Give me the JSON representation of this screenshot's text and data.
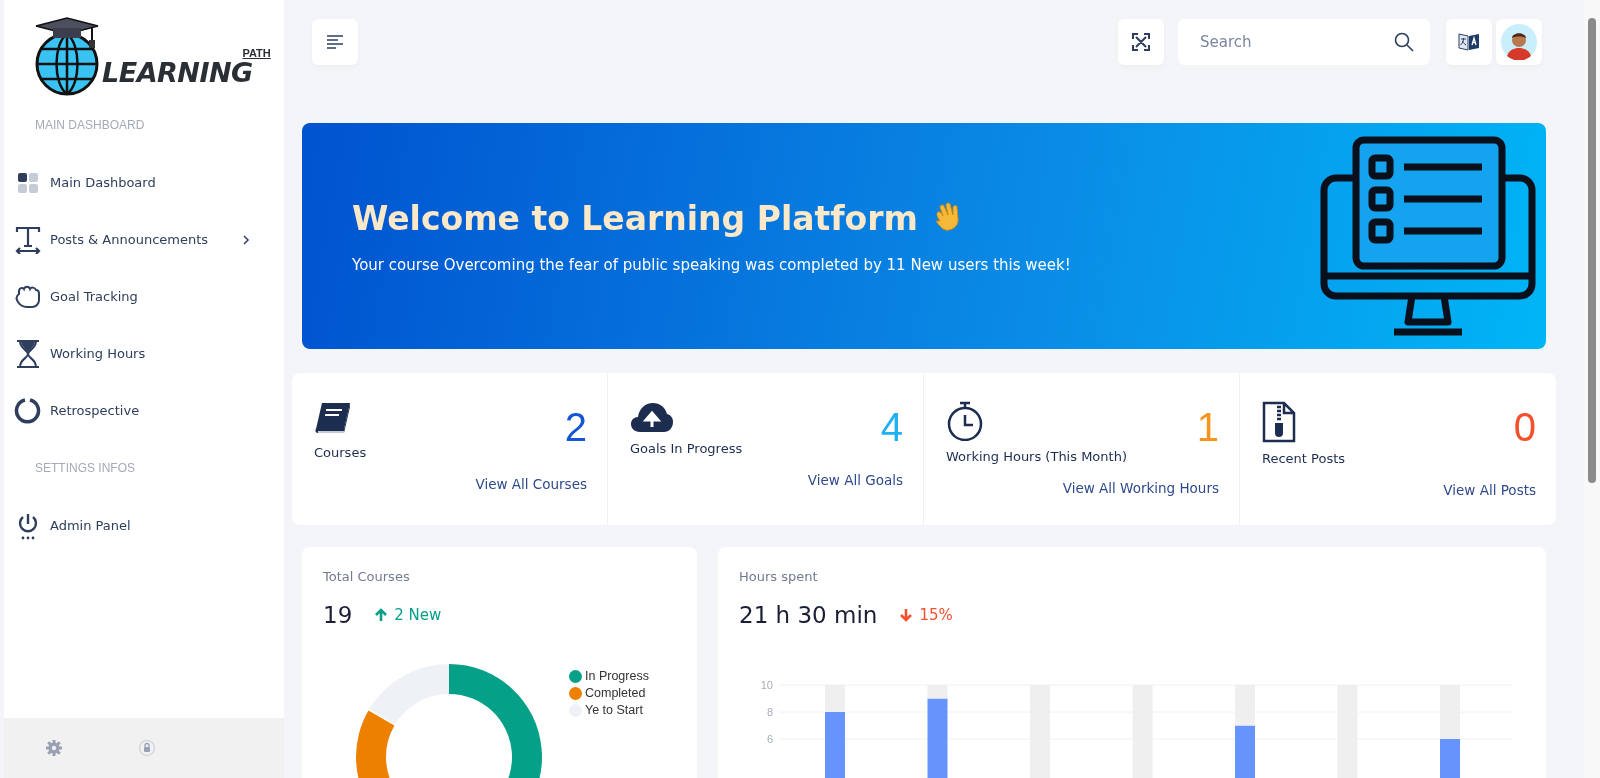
{
  "logo": {
    "word": "LEARNING",
    "tag": "PATH"
  },
  "sidebar": {
    "sections": [
      {
        "title": "MAIN DASHBOARD",
        "items": [
          {
            "label": "Main Dashboard",
            "has_submenu": false
          },
          {
            "label": "Posts & Announcements",
            "has_submenu": true
          },
          {
            "label": "Goal Tracking",
            "has_submenu": false
          },
          {
            "label": "Working Hours",
            "has_submenu": false
          },
          {
            "label": "Retrospective",
            "has_submenu": false
          }
        ]
      },
      {
        "title": "SETTINGS INFOS",
        "items": [
          {
            "label": "Admin Panel",
            "has_submenu": false
          }
        ]
      }
    ]
  },
  "topbar": {
    "search": {
      "placeholder": "Search"
    }
  },
  "banner": {
    "title": "Welcome to Learning Platform",
    "text": "Your course Overcoming the fear of public speaking was completed by 11 New users this week!"
  },
  "stats": [
    {
      "label": "Courses",
      "value": "2",
      "color": "#1457d4",
      "link": "View All Courses"
    },
    {
      "label": "Goals In Progress",
      "value": "4",
      "color": "#1eb0f0",
      "link": "View All Goals"
    },
    {
      "label": "Working Hours (This Month)",
      "value": "1",
      "color": "#f7941d",
      "link": "View All Working Hours"
    },
    {
      "label": "Recent Posts",
      "value": "0",
      "color": "#f4502c",
      "link": "View All Posts"
    }
  ],
  "total_courses": {
    "title": "Total Courses",
    "value": "19",
    "kind": "up",
    "change": "2 New",
    "legend": [
      {
        "label": "In Progress",
        "color": "#05a088"
      },
      {
        "label": "Completed",
        "color": "#ee8000"
      },
      {
        "label": "Ye to Start",
        "color": "#eef2f6"
      }
    ]
  },
  "hours_spent": {
    "title": "Hours spent",
    "value": "21 h 30 min",
    "kind": "down",
    "change": "15%",
    "chart_data": {
      "type": "bar",
      "stacked": true,
      "series": [
        {
          "color": "#6694fc",
          "values": [
            8,
            9,
            0,
            0,
            7,
            0,
            6
          ]
        },
        {
          "color": "#efefef",
          "values": [
            2,
            1,
            10,
            10,
            3,
            10,
            4
          ]
        }
      ],
      "ylim": [
        0,
        10
      ],
      "yticks": [
        6,
        8,
        10
      ]
    }
  }
}
